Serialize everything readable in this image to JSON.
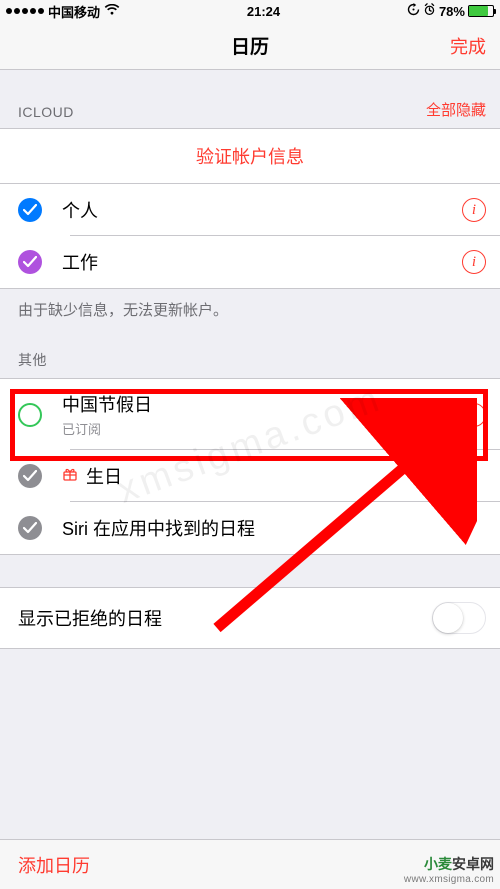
{
  "status": {
    "carrier": "中国移动",
    "time": "21:24",
    "battery_pct": "78%"
  },
  "nav": {
    "title": "日历",
    "done": "完成"
  },
  "icloud": {
    "section_label": "ICLOUD",
    "hide_all": "全部隐藏",
    "verify": "验证帐户信息",
    "items": [
      {
        "name": "个人"
      },
      {
        "name": "工作"
      }
    ],
    "footer": "由于缺少信息，无法更新帐户。"
  },
  "other": {
    "section_label": "其他",
    "items": [
      {
        "name": "中国节假日",
        "sub": "已订阅"
      },
      {
        "name": "生日"
      },
      {
        "name": "Siri 在应用中找到的日程"
      }
    ]
  },
  "declined": {
    "label": "显示已拒绝的日程"
  },
  "toolbar": {
    "add": "添加日历"
  },
  "watermark": {
    "center": "xmsigma.com",
    "brand1": "小麦",
    "brand2": "安卓网",
    "url": "www.xmsigma.com"
  }
}
